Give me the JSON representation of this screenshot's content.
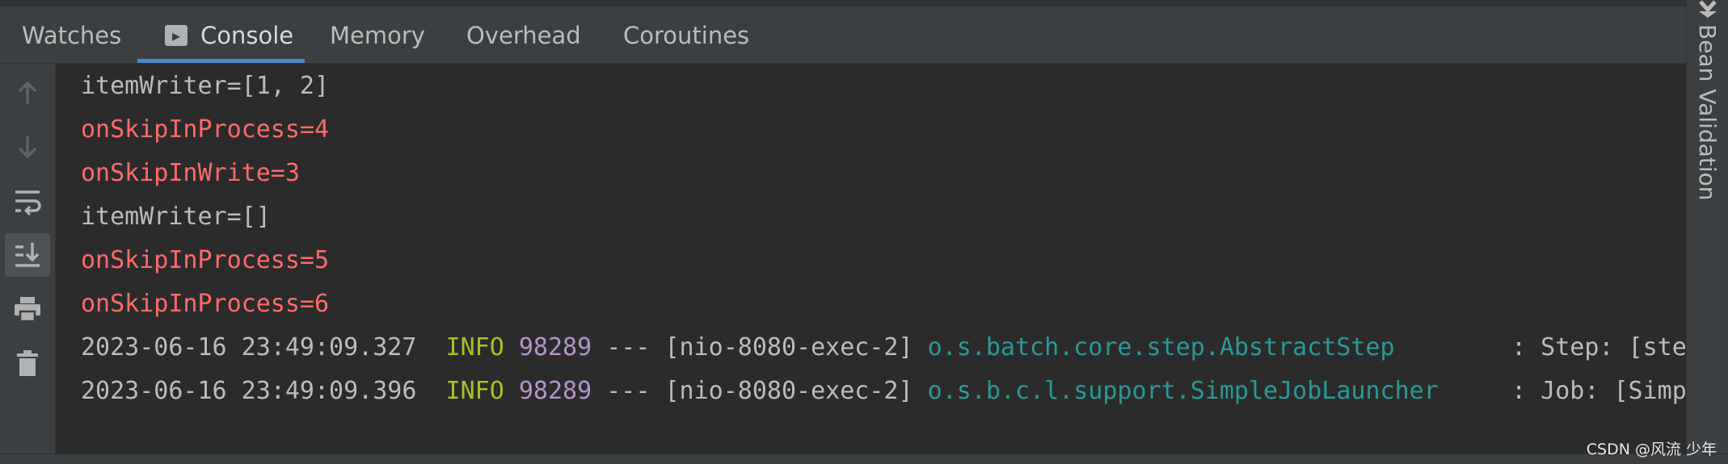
{
  "tabs": [
    {
      "label": "Watches",
      "active": false
    },
    {
      "label": "Console",
      "active": true
    },
    {
      "label": "Memory",
      "active": false
    },
    {
      "label": "Overhead",
      "active": false
    },
    {
      "label": "Coroutines",
      "active": false
    }
  ],
  "toolbar": {
    "icons": [
      "arrow-up-icon",
      "arrow-down-icon",
      "soft-wrap-icon",
      "scroll-to-end-icon",
      "print-icon",
      "trash-icon"
    ],
    "selected": "scroll-to-end-icon"
  },
  "console": {
    "line1": "itemWriter=[1, 2]",
    "line2": "onSkipInProcess=4",
    "line3": "onSkipInWrite=3",
    "line4": "itemWriter=[]",
    "line5": "onSkipInProcess=5",
    "line6": "onSkipInProcess=6",
    "log1": {
      "timestamp": "2023-06-16 23:49:09.327",
      "level": "INFO",
      "pid": "98289",
      "sep": "---",
      "thread": "[nio-8080-exec-2]",
      "logger": "o.s.batch.core.step.AbstractStep",
      "message": ": Step: [ste"
    },
    "log2": {
      "timestamp": "2023-06-16 23:49:09.396",
      "level": "INFO",
      "pid": "98289",
      "sep": "---",
      "thread": "[nio-8080-exec-2]",
      "logger": "o.s.b.c.l.support.SimpleJobLauncher",
      "message": ": Job: [Simp"
    }
  },
  "sidebar_right": {
    "label": "Bean Validation"
  },
  "watermark": "CSDN @风流 少年",
  "colors": {
    "error_text": "#ff6b68",
    "info_level": "#a8c023",
    "pid": "#b293cc",
    "logger": "#299999",
    "tab_underline": "#4a88c7"
  }
}
